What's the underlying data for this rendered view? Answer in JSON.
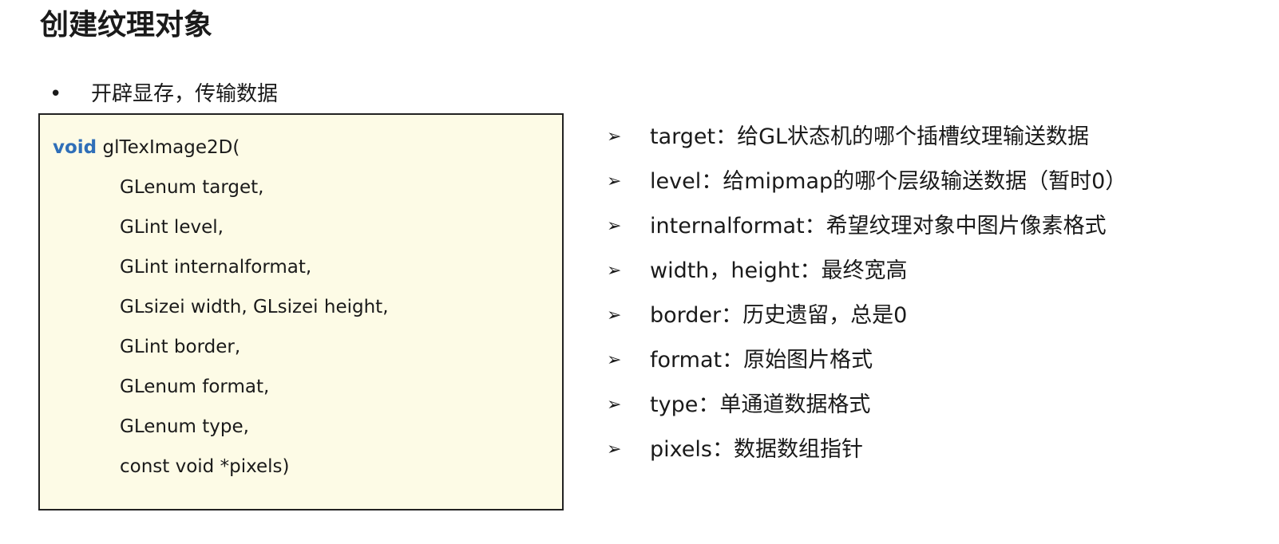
{
  "title": "创建纹理对象",
  "bullet": "开辟显存，传输数据",
  "code": {
    "keyword": "void",
    "function": "glTexImage2D(",
    "params": [
      "GLenum target,",
      "GLint level,",
      "GLint internalformat,",
      "GLsizei width, GLsizei height,",
      "GLint border,",
      "GLenum format,",
      "GLenum type,",
      "const void *pixels)"
    ],
    "keyword_color": "#2f6fb8",
    "background_color": "#fdfbe6"
  },
  "arrow_icon": "arrow-right-icon",
  "descriptions": [
    "target：给GL状态机的哪个插槽纹理输送数据",
    "level：给mipmap的哪个层级输送数据（暂时0）",
    "internalformat：希望纹理对象中图片像素格式",
    "width，height：最终宽高",
    "border：历史遗留，总是0",
    "format：原始图片格式",
    "type：单通道数据格式",
    "pixels：数据数组指针"
  ]
}
